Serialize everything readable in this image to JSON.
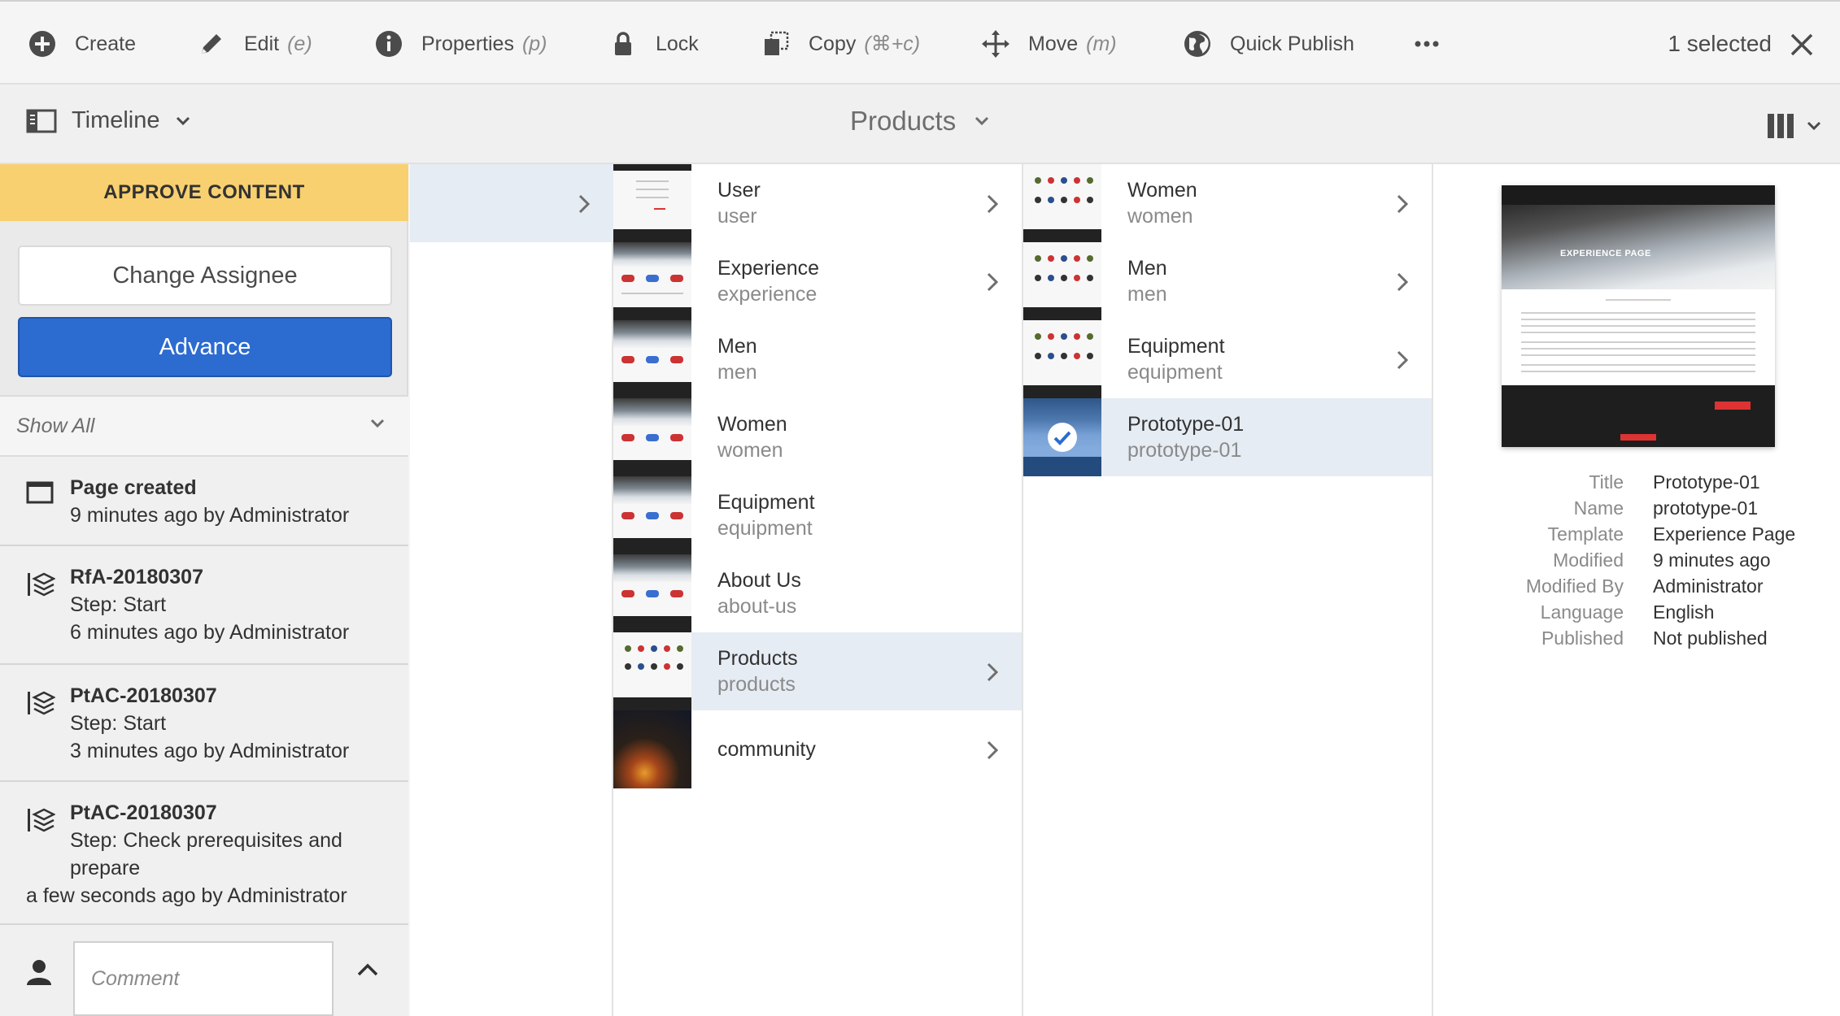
{
  "actions": {
    "create": "Create",
    "edit": "Edit",
    "edit_key": "(e)",
    "properties": "Properties",
    "properties_key": "(p)",
    "lock": "Lock",
    "copy": "Copy",
    "copy_key": "(⌘+c)",
    "move": "Move",
    "move_key": "(m)",
    "quick_publish": "Quick Publish",
    "selected": "1 selected"
  },
  "rail_toggle": {
    "label": "Timeline"
  },
  "location_title": "Products",
  "timeline": {
    "banner": "APPROVE CONTENT",
    "change_assignee": "Change Assignee",
    "advance": "Advance",
    "filter": "Show All",
    "items": [
      {
        "title": "Page created",
        "line2": "9 minutes ago by Administrator"
      },
      {
        "title": "RfA-20180307",
        "line2": "Step: Start",
        "line3": "6 minutes ago by Administrator"
      },
      {
        "title": "PtAC-20180307",
        "line2": "Step: Start",
        "line3": "3 minutes ago by Administrator"
      },
      {
        "title": "PtAC-20180307",
        "line2": "Step: Check prerequisites and",
        "line3": "prepare",
        "line4": "a few seconds ago by Administrator"
      }
    ],
    "comment_placeholder": "Comment"
  },
  "column2": [
    {
      "title": "User",
      "name": "user"
    },
    {
      "title": "Experience",
      "name": "experience"
    },
    {
      "title": "Men",
      "name": "men"
    },
    {
      "title": "Women",
      "name": "women"
    },
    {
      "title": "Equipment",
      "name": "equipment"
    },
    {
      "title": "About Us",
      "name": "about-us"
    },
    {
      "title": "Products",
      "name": "products"
    },
    {
      "title": "community"
    }
  ],
  "column3": [
    {
      "title": "Women",
      "name": "women"
    },
    {
      "title": "Men",
      "name": "men"
    },
    {
      "title": "Equipment",
      "name": "equipment"
    },
    {
      "title": "Prototype-01",
      "name": "prototype-01"
    }
  ],
  "preview": {
    "hero_title": "EXPERIENCE PAGE"
  },
  "details": [
    {
      "label": "Title",
      "value": "Prototype-01"
    },
    {
      "label": "Name",
      "value": "prototype-01"
    },
    {
      "label": "Template",
      "value": "Experience Page"
    },
    {
      "label": "Modified",
      "value": "9 minutes ago"
    },
    {
      "label": "Modified By",
      "value": "Administrator"
    },
    {
      "label": "Language",
      "value": "English"
    },
    {
      "label": "Published",
      "value": "Not published"
    }
  ],
  "colors": {
    "accent_blue": "#2c6bd0",
    "banner_yellow": "#f8d070",
    "selection_row": "#e6ecf4"
  },
  "icons": [
    "add-circle-icon",
    "pencil-icon",
    "info-icon",
    "lock-icon",
    "copy-icon",
    "move-icon",
    "globe-publish-icon",
    "more-icon",
    "close-icon",
    "rail-icon",
    "chevron-down-icon",
    "column-view-icon",
    "chevron-right-icon",
    "page-icon",
    "workflow-icon",
    "person-icon",
    "chevron-up-icon",
    "check-circle-icon"
  ]
}
